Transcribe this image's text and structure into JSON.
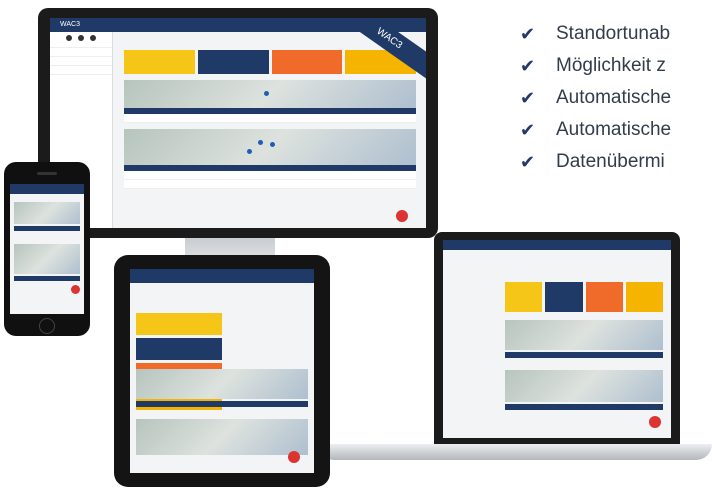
{
  "features": {
    "items": [
      "Standortunab",
      "Möglichkeit z",
      "Automatische",
      "Automatische",
      "Datenübermi"
    ]
  },
  "branding": {
    "ribbon": "WAC3",
    "app_title": "WAC3"
  },
  "colors": {
    "navy": "#1f3a66",
    "yellow": "#f5c518",
    "orange": "#f06a2a",
    "amber": "#f5b400",
    "red": "#d33333"
  }
}
